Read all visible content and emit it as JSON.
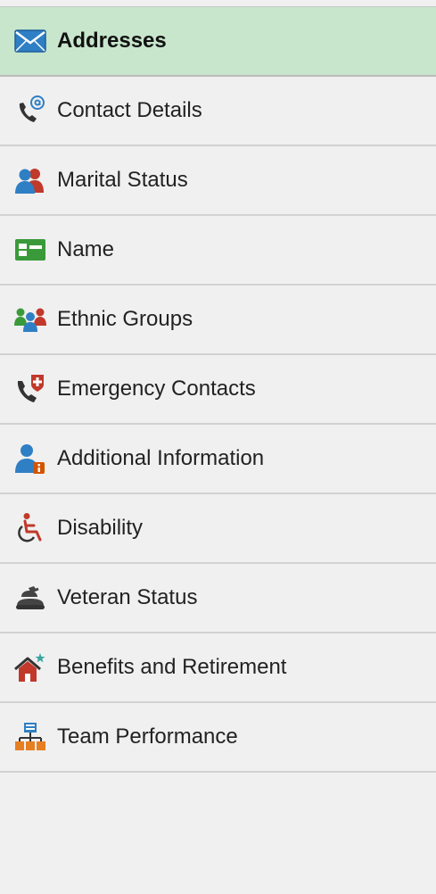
{
  "nav": {
    "items": [
      {
        "label": "Addresses",
        "icon": "envelope-icon",
        "selected": true
      },
      {
        "label": "Contact Details",
        "icon": "phone-at-icon",
        "selected": false
      },
      {
        "label": "Marital Status",
        "icon": "couple-icon",
        "selected": false
      },
      {
        "label": "Name",
        "icon": "id-card-icon",
        "selected": false
      },
      {
        "label": "Ethnic Groups",
        "icon": "group-icon",
        "selected": false
      },
      {
        "label": "Emergency Contacts",
        "icon": "emergency-phone-icon",
        "selected": false
      },
      {
        "label": "Additional Information",
        "icon": "person-info-icon",
        "selected": false
      },
      {
        "label": "Disability",
        "icon": "wheelchair-icon",
        "selected": false
      },
      {
        "label": "Veteran Status",
        "icon": "veteran-icon",
        "selected": false
      },
      {
        "label": "Benefits and Retirement",
        "icon": "house-star-icon",
        "selected": false
      },
      {
        "label": "Team Performance",
        "icon": "org-chart-icon",
        "selected": false
      }
    ]
  },
  "colors": {
    "selected_bg": "#c8e6cc",
    "panel_bg": "#f0f0f0",
    "divider": "#d2d2d2"
  }
}
